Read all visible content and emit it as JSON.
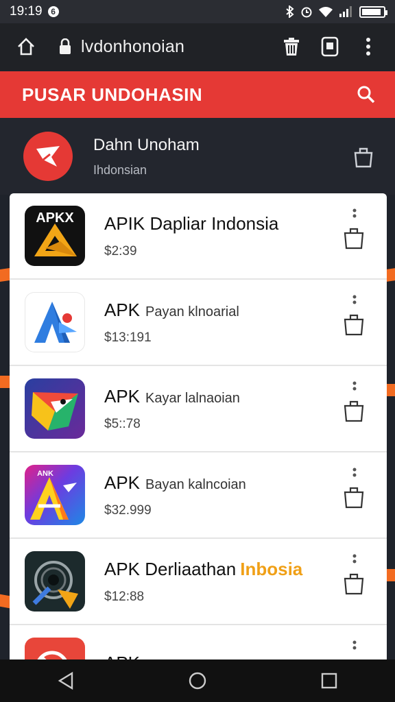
{
  "status_bar": {
    "time": "19:19",
    "badge": "6",
    "battery_level": 0.9
  },
  "browser": {
    "url": "lvdonhonoian"
  },
  "header": {
    "title": "PUSAR UNDOHASIN"
  },
  "account": {
    "name": "Dahn Unoham",
    "subtitle": "Ihdonsian"
  },
  "apps": [
    {
      "title": "APIK Dapliar Indonsia",
      "subtitle": "",
      "accent": "",
      "price": "$2:39",
      "icon_label": "APKX",
      "icon": "apk-gold-a-icon"
    },
    {
      "title": "APK",
      "subtitle": "Payan klnoarial",
      "accent": "",
      "price": "$13:191",
      "icon_label": "",
      "icon": "blue-a-icon"
    },
    {
      "title": "APK",
      "subtitle": "Kayar lalnaoian",
      "accent": "",
      "price": "$5::78",
      "icon_label": "",
      "icon": "triangle-arrow-icon"
    },
    {
      "title": "APK",
      "subtitle": "Bayan kalncoian",
      "accent": "",
      "price": "$32.999",
      "icon_label": "ANK",
      "icon": "colorful-a-icon"
    },
    {
      "title": "APK Derliaathan",
      "subtitle": "",
      "accent": "Inbosia",
      "price": "$12:88",
      "icon_label": "",
      "icon": "lens-tools-icon"
    },
    {
      "title": "APK",
      "subtitle": "",
      "accent": "",
      "price": "",
      "icon_label": "",
      "icon": "red-app-icon"
    }
  ],
  "colors": {
    "brand_red": "#e53935",
    "accent_orange": "#f26b21",
    "accent_gold": "#f0a017"
  }
}
